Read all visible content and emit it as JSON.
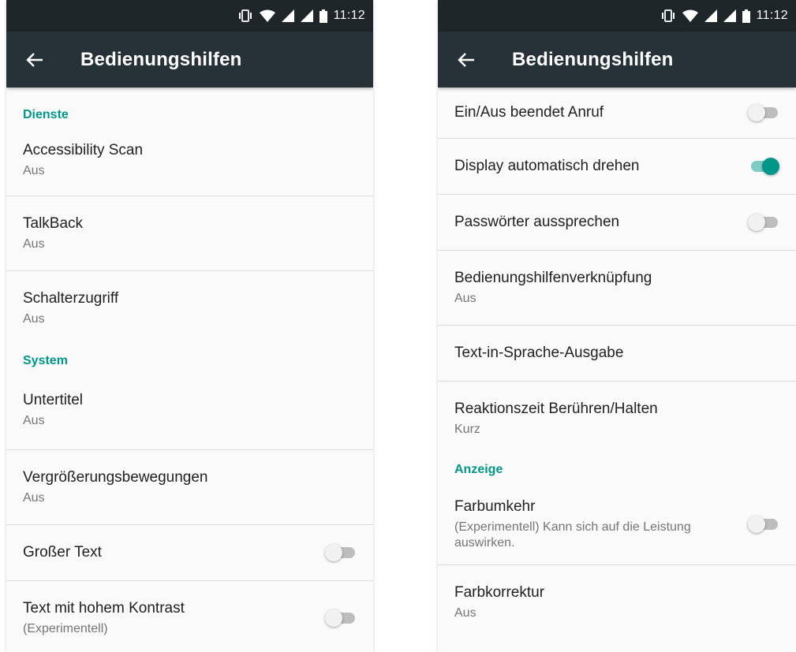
{
  "colors": {
    "accent": "#009688",
    "statusbar": "#1f262a",
    "appbar": "#263238"
  },
  "left": {
    "status": {
      "time": "11:12",
      "icons": [
        "vibrate-icon",
        "wifi-icon",
        "signal-icon",
        "signal-icon",
        "battery-icon"
      ]
    },
    "appbar": {
      "title": "Bedienungshilfen",
      "back_icon": "arrow-back-icon"
    },
    "sections": [
      {
        "header": "Dienste",
        "items": [
          {
            "title": "Accessibility Scan",
            "summary": "Aus"
          },
          {
            "title": "TalkBack",
            "summary": "Aus"
          },
          {
            "title": "Schalterzugriff",
            "summary": "Aus"
          }
        ]
      },
      {
        "header": "System",
        "items": [
          {
            "title": "Untertitel",
            "summary": "Aus"
          },
          {
            "title": "Vergrößerungsbewegungen",
            "summary": "Aus"
          },
          {
            "title": "Großer Text",
            "switch": false
          },
          {
            "title": "Text mit hohem Kontrast",
            "summary": "(Experimentell)",
            "switch": false
          }
        ]
      }
    ]
  },
  "right": {
    "status": {
      "time": "11:12",
      "icons": [
        "vibrate-icon",
        "wifi-icon",
        "signal-icon",
        "signal-icon",
        "battery-icon"
      ]
    },
    "appbar": {
      "title": "Bedienungshilfen",
      "back_icon": "arrow-back-icon"
    },
    "items_top": [
      {
        "title": "Ein/Aus beendet Anruf",
        "switch": false
      },
      {
        "title": "Display automatisch drehen",
        "switch": true
      },
      {
        "title": "Passwörter aussprechen",
        "switch": false
      },
      {
        "title": "Bedienungshilfenverknüpfung",
        "summary": "Aus"
      },
      {
        "title": "Text-in-Sprache-Ausgabe"
      },
      {
        "title": "Reaktionszeit Berühren/Halten",
        "summary": "Kurz"
      }
    ],
    "section_display": {
      "header": "Anzeige",
      "items": [
        {
          "title": "Farbumkehr",
          "summary": "(Experimentell) Kann sich auf die Leistung auswirken.",
          "switch": false
        },
        {
          "title": "Farbkorrektur",
          "summary": "Aus"
        }
      ]
    }
  }
}
